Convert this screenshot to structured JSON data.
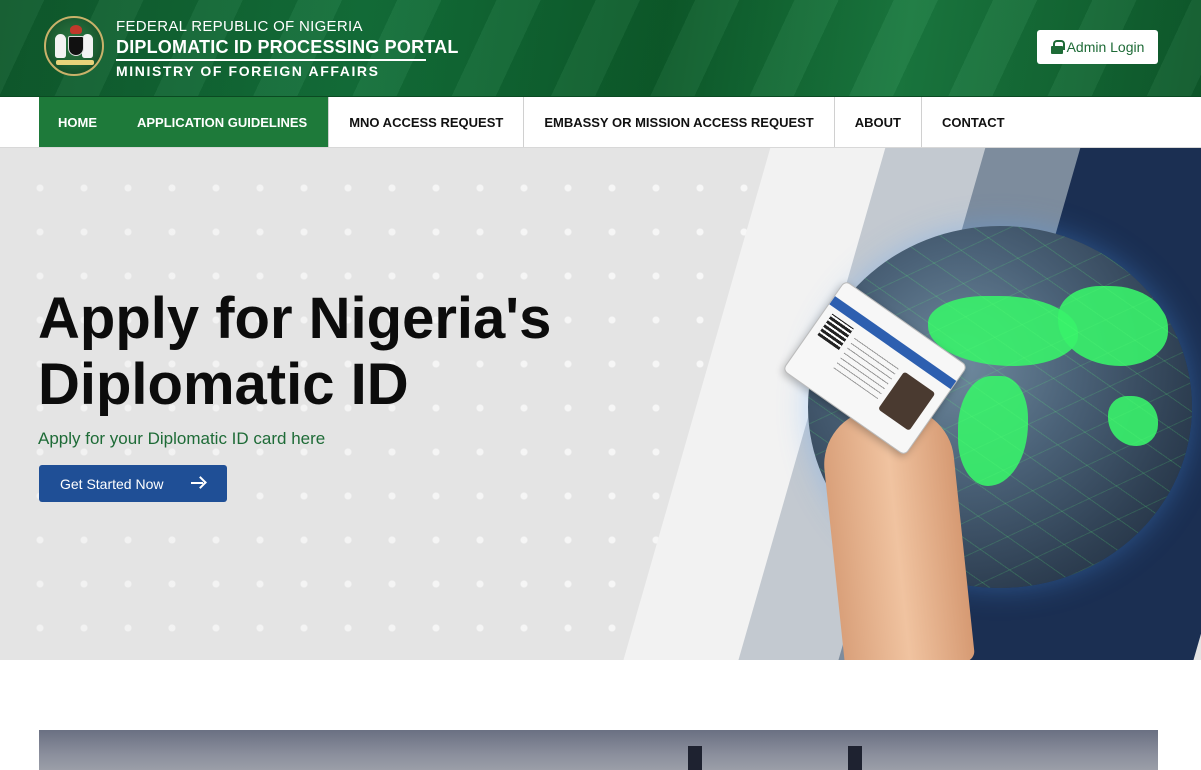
{
  "header": {
    "line1": "FEDERAL REPUBLIC OF NIGERIA",
    "line2": "DIPLOMATIC ID PROCESSING PORTAL",
    "line3": "MINISTRY OF FOREIGN AFFAIRS",
    "admin_login": "Admin Login"
  },
  "nav": {
    "items": [
      {
        "label": "HOME"
      },
      {
        "label": "APPLICATION GUIDELINES"
      },
      {
        "label": "MNO ACCESS REQUEST"
      },
      {
        "label": "EMBASSY OR MISSION ACCESS REQUEST"
      },
      {
        "label": "ABOUT"
      },
      {
        "label": "CONTACT"
      }
    ]
  },
  "hero": {
    "title": "Apply for Nigeria's Diplomatic ID",
    "subtitle": "Apply for your Diplomatic ID card here",
    "cta": "Get Started Now"
  },
  "colors": {
    "brand_green": "#1e7a3a",
    "cta_blue": "#1f4f96",
    "header_green": "#13703a"
  }
}
